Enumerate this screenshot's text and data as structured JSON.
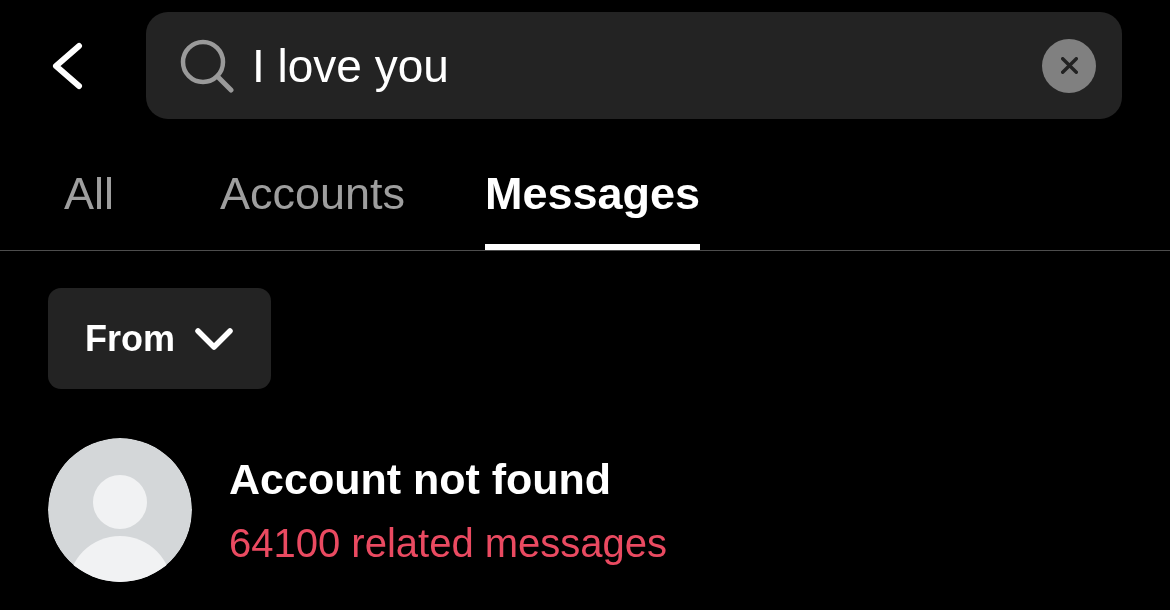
{
  "search": {
    "value": "I love you"
  },
  "tabs": [
    {
      "label": "All",
      "selected": false
    },
    {
      "label": "Accounts",
      "selected": false
    },
    {
      "label": "Messages",
      "selected": true
    }
  ],
  "filter": {
    "label": "From"
  },
  "results": [
    {
      "name": "Account not found",
      "detail": "64100 related messages"
    }
  ]
}
